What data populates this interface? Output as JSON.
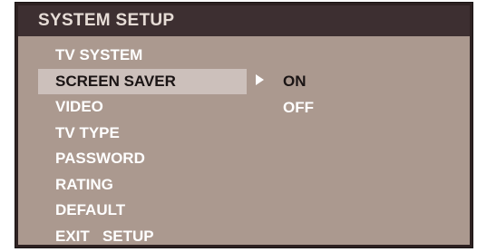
{
  "osd": {
    "title": "SYSTEM SETUP",
    "menu": {
      "selected_index": 1,
      "items": [
        {
          "label": "TV SYSTEM"
        },
        {
          "label": "SCREEN SAVER"
        },
        {
          "label": "VIDEO"
        },
        {
          "label": "TV TYPE"
        },
        {
          "label": "PASSWORD"
        },
        {
          "label": "RATING"
        },
        {
          "label": "DEFAULT"
        },
        {
          "label": "EXIT   SETUP"
        }
      ]
    },
    "submenu": {
      "pointer_icon": "triangle-right-icon",
      "current_value": "ON",
      "options": [
        {
          "label": "ON"
        },
        {
          "label": "OFF"
        }
      ]
    },
    "colors": {
      "panel_background": "#ab998f",
      "title_bar": "#3d2f31",
      "highlight": "#ccc0bb",
      "text": "#ffffff",
      "highlight_text": "#1a1414"
    }
  }
}
